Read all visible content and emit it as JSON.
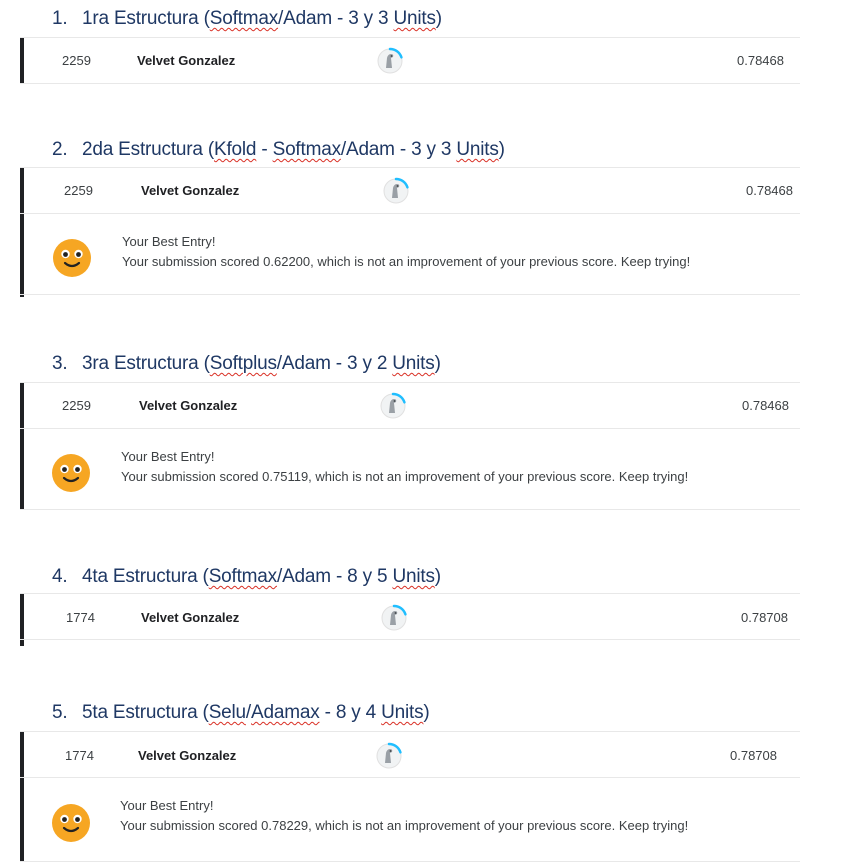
{
  "sections": [
    {
      "number": "1.",
      "title_parts": [
        {
          "t": "1ra Estructura (",
          "sq": false
        },
        {
          "t": "Softmax",
          "sq": true
        },
        {
          "t": "/Adam - 3 y 3 ",
          "sq": false
        },
        {
          "t": "Units",
          "sq": true
        },
        {
          "t": ")",
          "sq": false
        }
      ],
      "rank": "2259",
      "name": "Velvet Gonzalez",
      "score": "0.78468",
      "message": null
    },
    {
      "number": "2.",
      "title_parts": [
        {
          "t": "2da Estructura (",
          "sq": false
        },
        {
          "t": "Kfold",
          "sq": true
        },
        {
          "t": " - ",
          "sq": false
        },
        {
          "t": "Softmax",
          "sq": true
        },
        {
          "t": "/Adam - 3 y 3 ",
          "sq": false
        },
        {
          "t": "Units",
          "sq": true
        },
        {
          "t": ")",
          "sq": false
        }
      ],
      "rank": "2259",
      "name": "Velvet Gonzalez",
      "score": "0.78468",
      "message": {
        "title": "Your Best Entry!",
        "text": "Your submission scored 0.62200, which is not an improvement of your previous score. Keep trying!"
      }
    },
    {
      "number": "3.",
      "title_parts": [
        {
          "t": "3ra Estructura (",
          "sq": false
        },
        {
          "t": "Softplus",
          "sq": true
        },
        {
          "t": "/Adam - 3 y 2 ",
          "sq": false
        },
        {
          "t": "Units",
          "sq": true
        },
        {
          "t": ")",
          "sq": false
        }
      ],
      "rank": "2259",
      "name": "Velvet Gonzalez",
      "score": "0.78468",
      "message": {
        "title": "Your Best Entry!",
        "text": "Your submission scored 0.75119, which is not an improvement of your previous score. Keep trying!"
      }
    },
    {
      "number": "4.",
      "title_parts": [
        {
          "t": "4ta Estructura (",
          "sq": false
        },
        {
          "t": "Softmax",
          "sq": true
        },
        {
          "t": "/Adam - 8 y 5 ",
          "sq": false
        },
        {
          "t": "Units",
          "sq": true
        },
        {
          "t": ")",
          "sq": false
        }
      ],
      "rank": "1774",
      "name": "Velvet Gonzalez",
      "score": "0.78708",
      "message": null
    },
    {
      "number": "5.",
      "title_parts": [
        {
          "t": "5ta Estructura (",
          "sq": false
        },
        {
          "t": "Selu",
          "sq": true
        },
        {
          "t": "/",
          "sq": false
        },
        {
          "t": "Adamax",
          "sq": true
        },
        {
          "t": " - 8 y 4 ",
          "sq": false
        },
        {
          "t": "Units",
          "sq": true
        },
        {
          "t": ")",
          "sq": false
        }
      ],
      "rank": "1774",
      "name": "Velvet Gonzalez",
      "score": "0.78708",
      "message": {
        "title": "Your Best Entry!",
        "text": "Your submission scored 0.78229, which is not an improvement of your previous score. Keep trying!"
      }
    }
  ],
  "icons": {
    "avatar": "user-avatar-icon",
    "smiley": "smiley-face-icon"
  },
  "colors": {
    "heading": "#1f3864",
    "accent_bar": "#202124",
    "avatar_ring": "#20beff",
    "smiley": "#f6a623"
  }
}
